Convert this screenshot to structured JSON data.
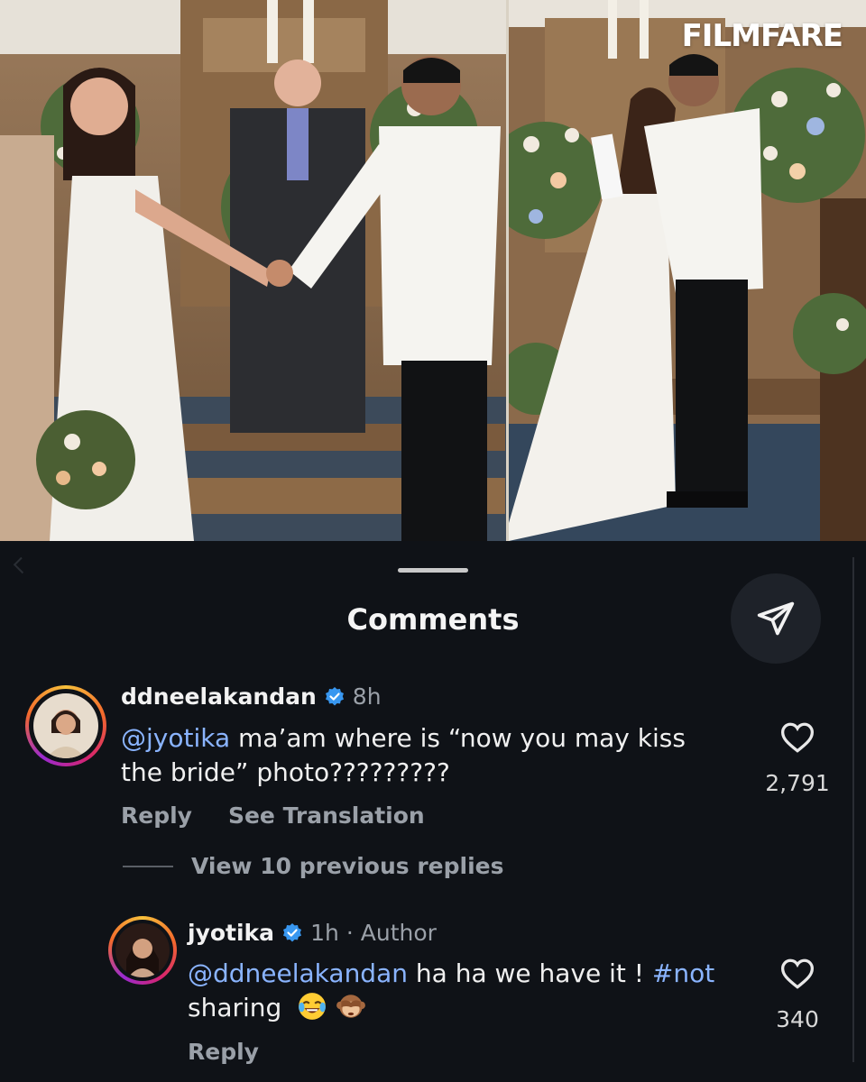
{
  "brand": {
    "logo_text": "FILMFARE"
  },
  "sheet": {
    "title": "Comments"
  },
  "comments": [
    {
      "username": "ddneelakandan",
      "verified": true,
      "time": "8h",
      "mention": "@jyotika",
      "text": " ma’am where is “now you may kiss the bride” photo?????????",
      "likes": "2,791",
      "reply_label": "Reply",
      "translate_label": "See Translation"
    }
  ],
  "replies_toggle": {
    "label": "View 10 previous replies"
  },
  "reply": {
    "username": "jyotika",
    "verified": true,
    "time": "1h",
    "separator": "·",
    "role": "Author",
    "mention": "@ddneelakandan",
    "text_1": " ha ha we have it ! ",
    "hashtag": "#not",
    "text_2": "sharing",
    "likes": "340",
    "reply_label": "Reply"
  },
  "icons": {
    "share": "send-icon",
    "like": "heart-outline-icon",
    "verified": "verified-badge-icon",
    "emoji_1": "face-with-tears-of-joy-emoji",
    "emoji_2": "see-no-evil-monkey-emoji"
  },
  "colors": {
    "background": "#0f1217",
    "link": "#8ab4ff",
    "verified": "#3897f0",
    "muted_text": "#9aa0a8"
  }
}
